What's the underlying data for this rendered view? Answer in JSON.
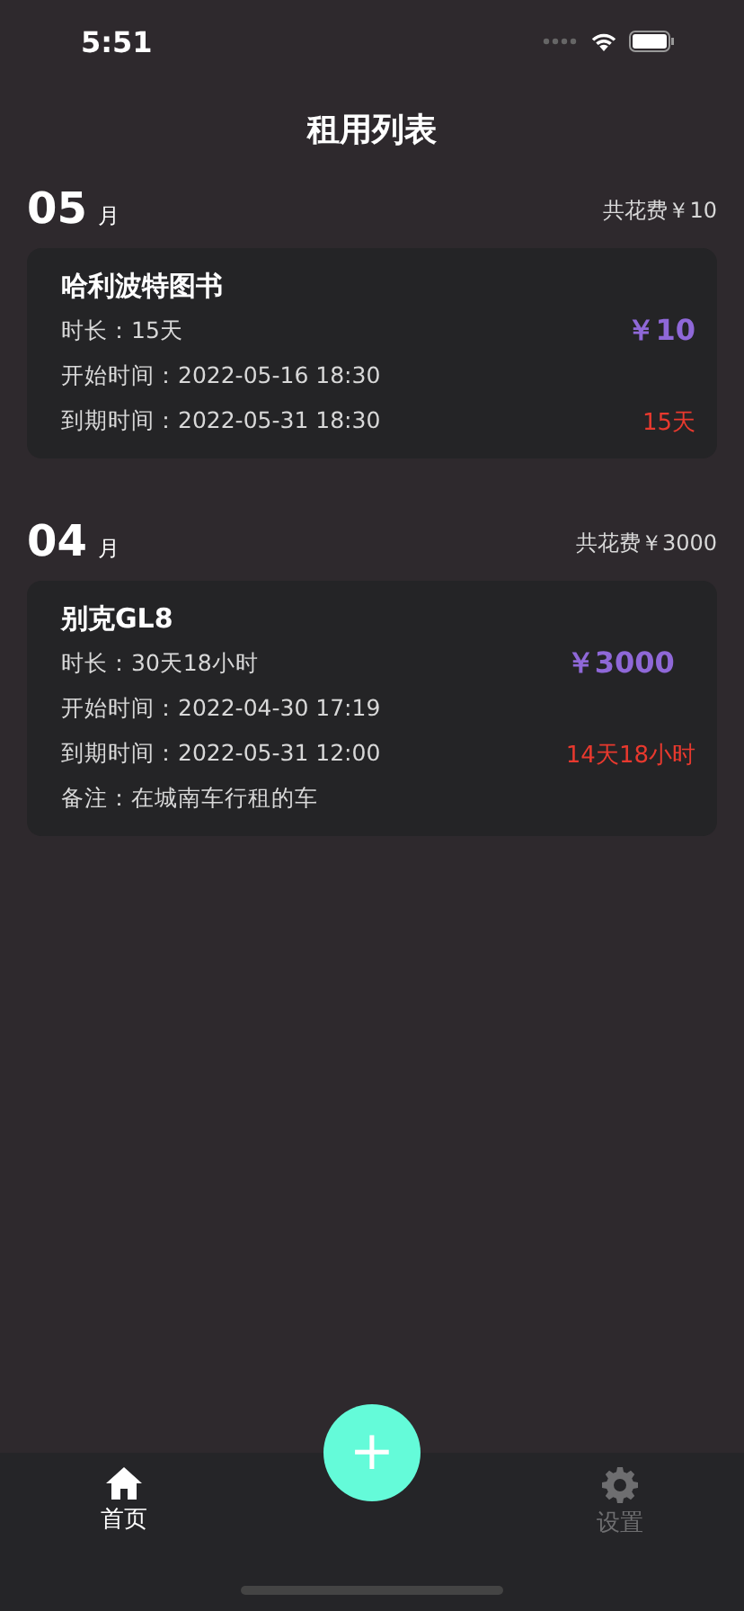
{
  "status_bar": {
    "time": "5:51"
  },
  "title": "租用列表",
  "months": [
    {
      "month": "05",
      "unit": "月",
      "total": "共花费￥10",
      "rentals": [
        {
          "name": "哈利波特图书",
          "price": "￥10",
          "remaining": "15天",
          "lines": [
            "时长：15天",
            "开始时间：2022-05-16 18:30",
            "到期时间：2022-05-31 18:30"
          ]
        }
      ]
    },
    {
      "month": "04",
      "unit": "月",
      "total": "共花费￥3000",
      "rentals": [
        {
          "name": "别克GL8",
          "price": "￥3000",
          "remaining": "14天18小时",
          "lines": [
            "时长：30天18小时",
            "开始时间：2022-04-30 17:19",
            "到期时间：2022-05-31 12:00",
            "备注：在城南车行租的车"
          ]
        }
      ]
    }
  ],
  "add_button": {
    "label": "+"
  },
  "tabs": [
    {
      "kind": "home",
      "label": "首页",
      "selected": true
    },
    {
      "kind": "settings",
      "label": "设置",
      "selected": false
    }
  ]
}
